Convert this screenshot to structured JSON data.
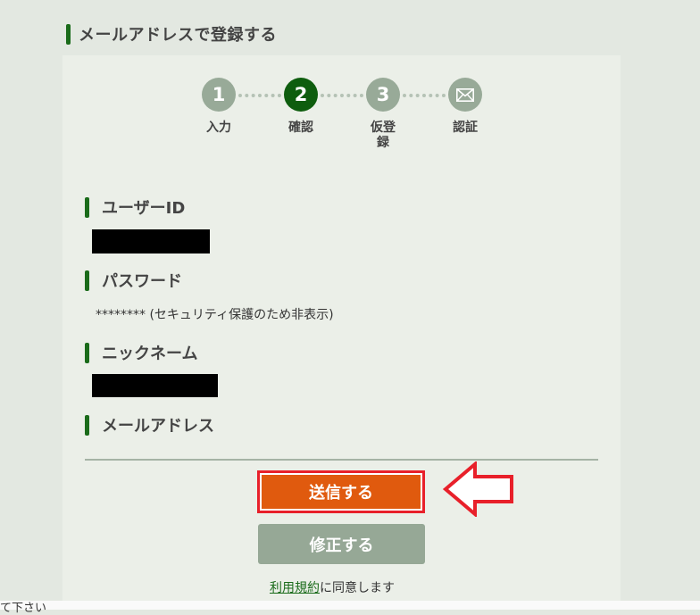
{
  "page": {
    "heading": "メールアドレスで登録する"
  },
  "steps": [
    {
      "number": "1",
      "label": "入力"
    },
    {
      "number": "2",
      "label": "確認"
    },
    {
      "number": "3",
      "label": "仮登録"
    },
    {
      "icon": "envelope-icon",
      "label": "認証"
    }
  ],
  "current_step": 2,
  "fields": {
    "user_id_label": "ユーザーID",
    "password_label": "パスワード",
    "password_value": "******** (セキュリティ保護のため非表示)",
    "nickname_label": "ニックネーム",
    "email_label": "メールアドレス"
  },
  "buttons": {
    "send_label": "送信する",
    "fix_label": "修正する"
  },
  "terms": {
    "link_text": "利用規約",
    "suffix_text": "に同意します"
  },
  "bottom": {
    "partial_text": "て下さい"
  },
  "colors": {
    "accent_green": "#1a6b1a",
    "active_step": "#0e5d0e",
    "send_button": "#e05a0e",
    "annotation_red": "#e8202a"
  }
}
